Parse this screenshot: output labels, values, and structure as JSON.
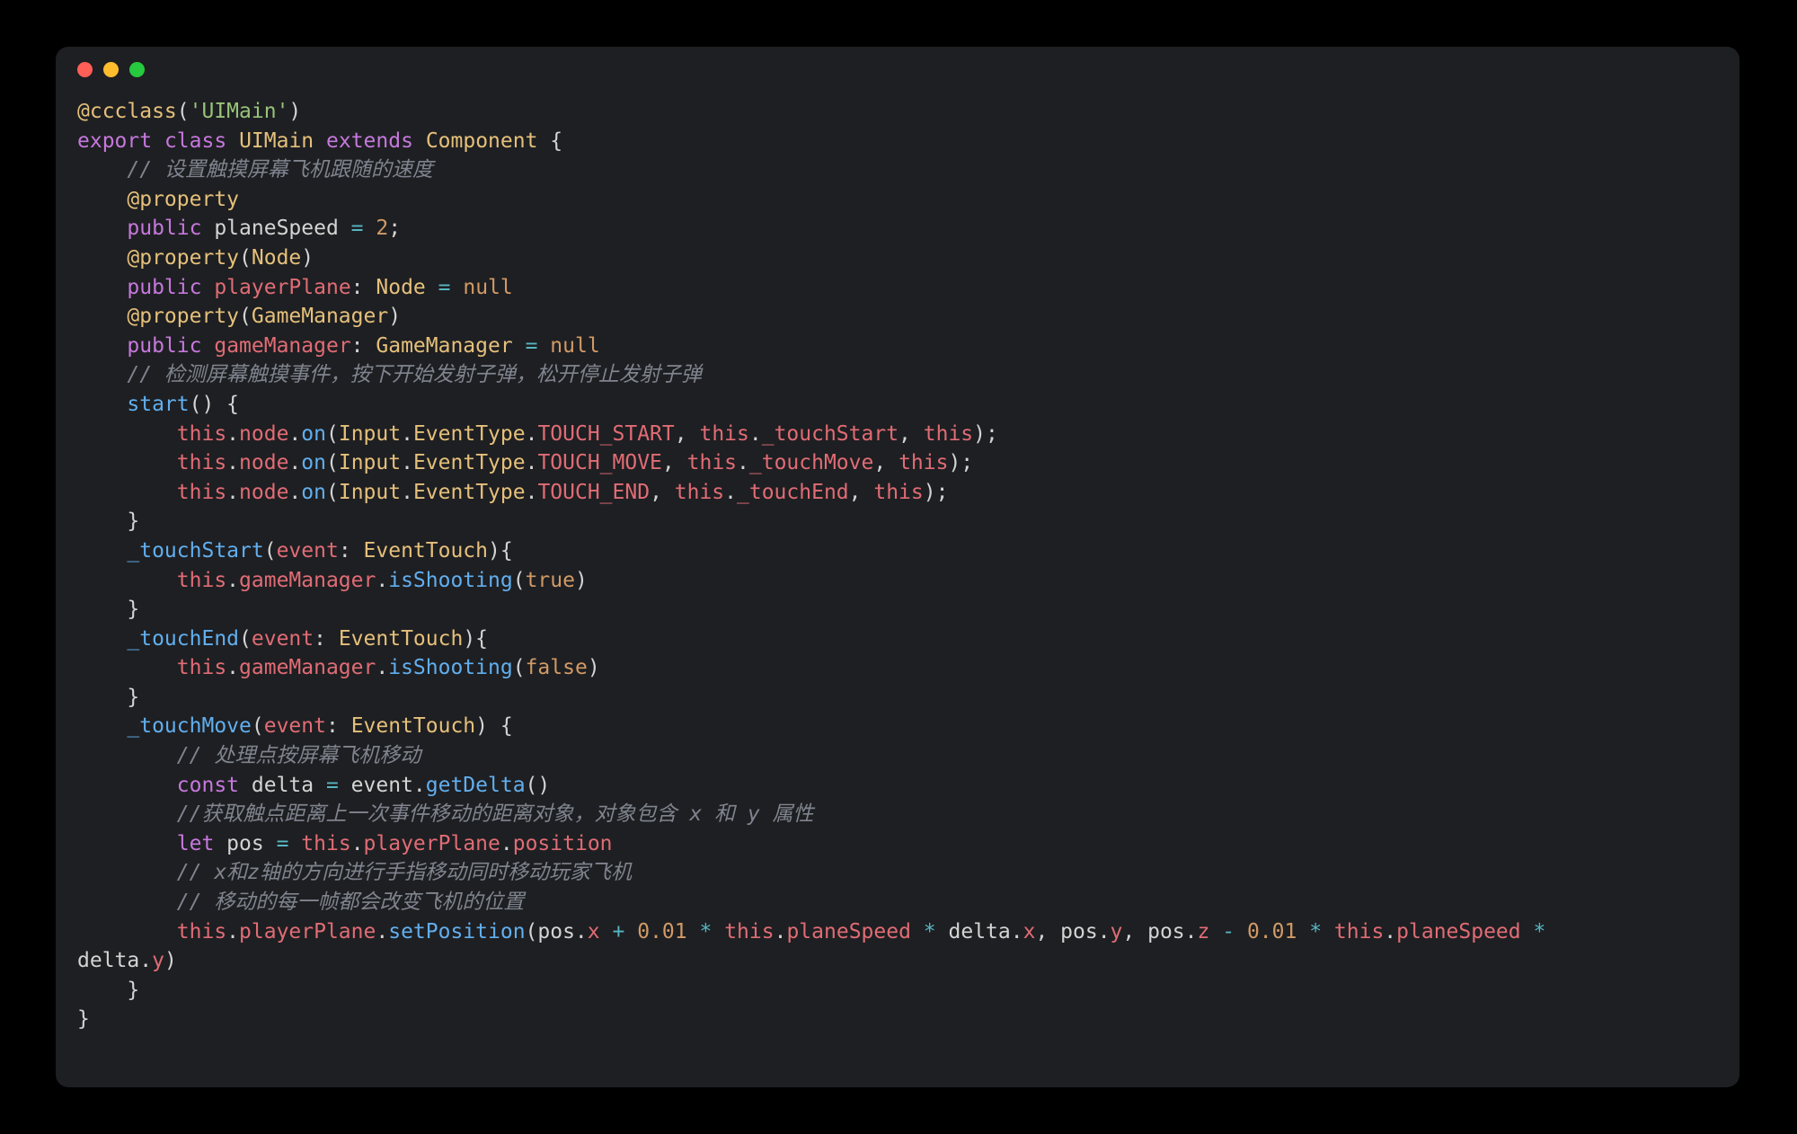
{
  "colors": {
    "background": "#1e1f22",
    "dot_red": "#ff5f56",
    "dot_yellow": "#ffbd2e",
    "dot_green": "#27c93f"
  },
  "code": {
    "l01": {
      "a": "@ccclass",
      "b": "(",
      "c": "'UIMain'",
      "d": ")"
    },
    "l02": {
      "a": "export",
      "b": " ",
      "c": "class",
      "d": " ",
      "e": "UIMain",
      "f": " ",
      "g": "extends",
      "h": " ",
      "i": "Component",
      "j": " {"
    },
    "l03": {
      "a": "    ",
      "b": "// 设置触摸屏幕飞机跟随的速度"
    },
    "l04": {
      "a": "    ",
      "b": "@property"
    },
    "l05": {
      "a": "    ",
      "b": "public",
      "c": " planeSpeed ",
      "d": "=",
      "e": " ",
      "f": "2",
      "g": ";"
    },
    "l06": {
      "a": "    ",
      "b": "@property",
      "c": "(",
      "d": "Node",
      "e": ")"
    },
    "l07": {
      "a": "    ",
      "b": "public",
      "c": " ",
      "d": "playerPlane",
      "e": ": ",
      "f": "Node",
      "g": " ",
      "h": "=",
      "i": " ",
      "j": "null"
    },
    "l08": {
      "a": "    ",
      "b": "@property",
      "c": "(",
      "d": "GameManager",
      "e": ")"
    },
    "l09": {
      "a": "    ",
      "b": "public",
      "c": " ",
      "d": "gameManager",
      "e": ": ",
      "f": "GameManager",
      "g": " ",
      "h": "=",
      "i": " ",
      "j": "null"
    },
    "l10": {
      "a": "    ",
      "b": "// 检测屏幕触摸事件，按下开始发射子弹，松开停止发射子弹"
    },
    "l11": {
      "a": "    ",
      "b": "start",
      "c": "() {"
    },
    "l12": {
      "a": "        ",
      "b": "this",
      "c": ".",
      "d": "node",
      "e": ".",
      "f": "on",
      "g": "(",
      "h": "Input",
      "i": ".",
      "j": "EventType",
      "k": ".",
      "l": "TOUCH_START",
      "m": ", ",
      "n": "this",
      "o": ".",
      "p": "_touchStart",
      "q": ", ",
      "r": "this",
      "s": ");"
    },
    "l13": {
      "a": "        ",
      "b": "this",
      "c": ".",
      "d": "node",
      "e": ".",
      "f": "on",
      "g": "(",
      "h": "Input",
      "i": ".",
      "j": "EventType",
      "k": ".",
      "l": "TOUCH_MOVE",
      "m": ", ",
      "n": "this",
      "o": ".",
      "p": "_touchMove",
      "q": ", ",
      "r": "this",
      "s": ");"
    },
    "l14": {
      "a": "        ",
      "b": "this",
      "c": ".",
      "d": "node",
      "e": ".",
      "f": "on",
      "g": "(",
      "h": "Input",
      "i": ".",
      "j": "EventType",
      "k": ".",
      "l": "TOUCH_END",
      "m": ", ",
      "n": "this",
      "o": ".",
      "p": "_touchEnd",
      "q": ", ",
      "r": "this",
      "s": ");"
    },
    "l15": {
      "a": "    }"
    },
    "l16": {
      "a": "    ",
      "b": "_touchStart",
      "c": "(",
      "d": "event",
      "e": ": ",
      "f": "EventTouch",
      "g": "){"
    },
    "l17": {
      "a": "        ",
      "b": "this",
      "c": ".",
      "d": "gameManager",
      "e": ".",
      "f": "isShooting",
      "g": "(",
      "h": "true",
      "i": ")"
    },
    "l18": {
      "a": "    }"
    },
    "l19": {
      "a": "    ",
      "b": "_touchEnd",
      "c": "(",
      "d": "event",
      "e": ": ",
      "f": "EventTouch",
      "g": "){"
    },
    "l20": {
      "a": "        ",
      "b": "this",
      "c": ".",
      "d": "gameManager",
      "e": ".",
      "f": "isShooting",
      "g": "(",
      "h": "false",
      "i": ")"
    },
    "l21": {
      "a": "    }"
    },
    "l22": {
      "a": "    ",
      "b": "_touchMove",
      "c": "(",
      "d": "event",
      "e": ": ",
      "f": "EventTouch",
      "g": ") {"
    },
    "l23": {
      "a": "        ",
      "b": "// 处理点按屏幕飞机移动"
    },
    "l24": {
      "a": "        ",
      "b": "const",
      "c": " delta ",
      "d": "=",
      "e": " event.",
      "f": "getDelta",
      "g": "()"
    },
    "l25": {
      "a": "        ",
      "b": "//获取触点距离上一次事件移动的距离对象，对象包含 x 和 y 属性"
    },
    "l26": {
      "a": "        ",
      "b": "let",
      "c": " pos ",
      "d": "=",
      "e": " ",
      "f": "this",
      "g": ".",
      "h": "playerPlane",
      "i": ".",
      "j": "position"
    },
    "l27": {
      "a": "        ",
      "b": "// x和z轴的方向进行手指移动同时移动玩家飞机"
    },
    "l28": {
      "a": "        ",
      "b": "// 移动的每一帧都会改变飞机的位置"
    },
    "l29": {
      "a": "        ",
      "b": "this",
      "c": ".",
      "d": "playerPlane",
      "e": ".",
      "f": "setPosition",
      "g": "(pos.",
      "h": "x",
      "i": " ",
      "j": "+",
      "k": " ",
      "l": "0.01",
      "m": " ",
      "n": "*",
      "o": " ",
      "p": "this",
      "q": ".",
      "r": "planeSpeed",
      "s": " ",
      "t": "*",
      "u": " delta.",
      "v": "x",
      "w": ", pos.",
      "x": "y",
      "y": ", pos.",
      "z": "z",
      "aa": " ",
      "ab": "-",
      "ac": " ",
      "ad": "0.01",
      "ae": " ",
      "af": "*",
      "ag": " ",
      "ah": "this",
      "ai": ".",
      "aj": "planeSpeed",
      "ak": " ",
      "al": "*",
      "am": " "
    },
    "l30": {
      "a": "delta.",
      "b": "y",
      "c": ")"
    },
    "l31": {
      "a": "    }"
    },
    "l32": {
      "a": "}"
    }
  }
}
